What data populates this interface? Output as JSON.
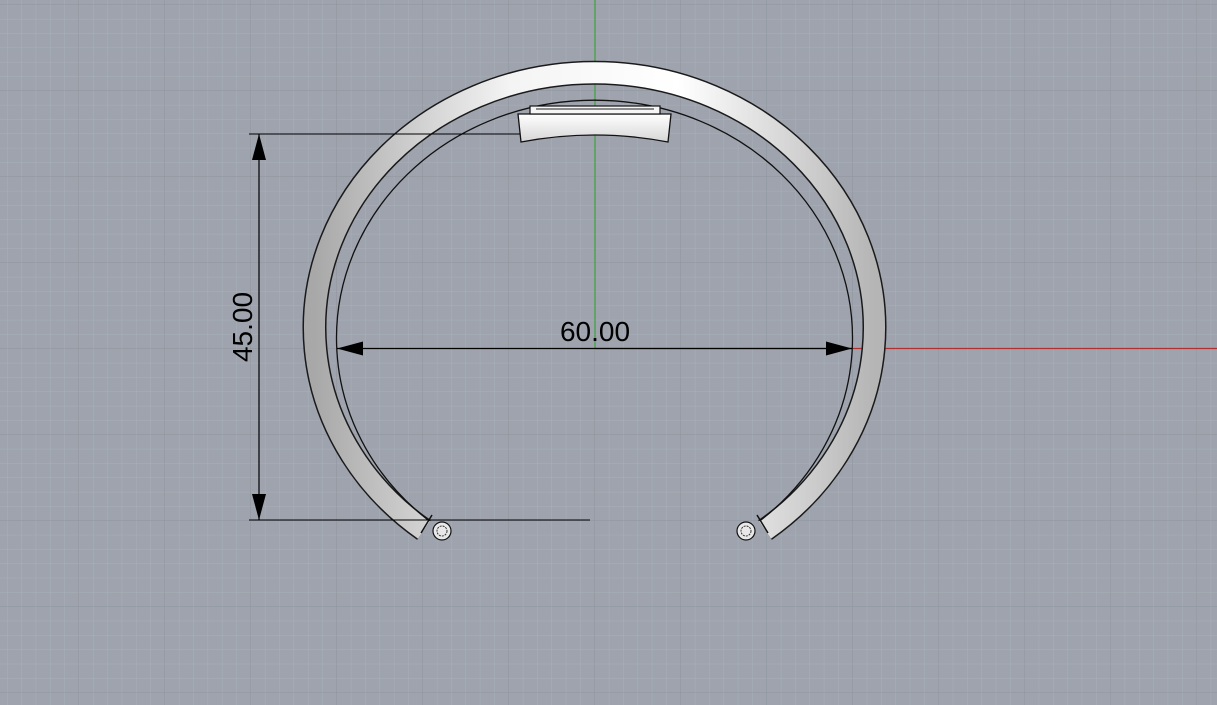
{
  "viewport": {
    "background": "#9ea3ad",
    "minor_grid_color": "#a9aeb7",
    "major_grid_color": "#8d929b",
    "x_axis_color": "#b03030",
    "y_axis_color": "#3da23d"
  },
  "dimensions": {
    "width_label": "60.00",
    "height_label": "45.00"
  },
  "model": {
    "object": "cuff-bracelet",
    "open_ends": 2,
    "features": [
      "top-mount-plate",
      "end-caps"
    ]
  }
}
